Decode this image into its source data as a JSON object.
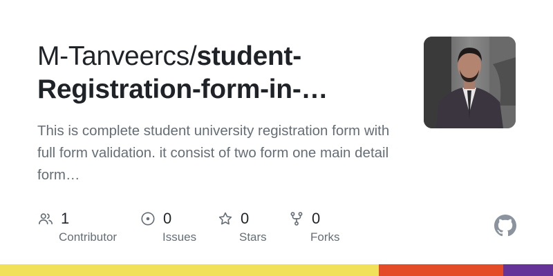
{
  "repo": {
    "owner": "M-Tanveercs/",
    "name_line1": "student-",
    "name_line2": "Registration-form-in-…",
    "description": "This is complete student university registration form with full form validation. it consist of two form one main detail form…"
  },
  "avatar": {
    "icon": "user-avatar-photo"
  },
  "stats": [
    {
      "icon": "people-icon",
      "value": "1",
      "label": "Contributor"
    },
    {
      "icon": "issue-icon",
      "value": "0",
      "label": "Issues"
    },
    {
      "icon": "star-icon",
      "value": "0",
      "label": "Stars"
    },
    {
      "icon": "fork-icon",
      "value": "0",
      "label": "Forks"
    }
  ],
  "logo": {
    "icon": "github-icon"
  },
  "language_bar": [
    {
      "color": "#f1e05a",
      "share": 0.685
    },
    {
      "color": "#e34c26",
      "share": 0.225
    },
    {
      "color": "#663399",
      "share": 0.09
    }
  ]
}
